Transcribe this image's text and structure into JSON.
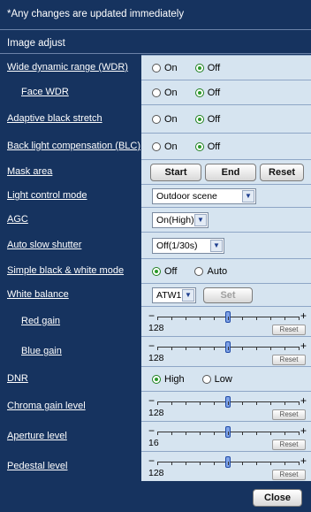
{
  "notice": "*Any changes are updated immediately",
  "section_title": "Image adjust",
  "rows": {
    "wdr": {
      "label": "Wide dynamic range (WDR)",
      "on": "On",
      "off": "Off",
      "selected": "off"
    },
    "face_wdr": {
      "label": "Face WDR",
      "on": "On",
      "off": "Off",
      "selected": "off"
    },
    "abs": {
      "label": "Adaptive black stretch",
      "on": "On",
      "off": "Off",
      "selected": "off"
    },
    "blc": {
      "label": "Back light compensation (BLC)",
      "on": "On",
      "off": "Off",
      "selected": "off"
    },
    "mask": {
      "label": "Mask area",
      "start": "Start",
      "end": "End",
      "reset": "Reset"
    },
    "light": {
      "label": "Light control mode",
      "value": "Outdoor scene"
    },
    "agc": {
      "label": "AGC",
      "value": "On(High)"
    },
    "shutter": {
      "label": "Auto slow shutter",
      "value": "Off(1/30s)"
    },
    "bw": {
      "label": "Simple black & white mode",
      "off": "Off",
      "auto": "Auto",
      "selected": "off"
    },
    "wb": {
      "label": "White balance",
      "value": "ATW1",
      "set": "Set"
    },
    "red_gain": {
      "label": "Red gain",
      "value": "128",
      "reset": "Reset",
      "level": 0.5
    },
    "blue_gain": {
      "label": "Blue gain",
      "value": "128",
      "reset": "Reset",
      "level": 0.5
    },
    "dnr": {
      "label": "DNR",
      "high": "High",
      "low": "Low",
      "selected": "high"
    },
    "chroma": {
      "label": "Chroma gain level",
      "value": "128",
      "reset": "Reset",
      "level": 0.5
    },
    "aperture": {
      "label": "Aperture level",
      "value": "16",
      "reset": "Reset",
      "level": 0.5
    },
    "pedestal": {
      "label": "Pedestal level",
      "value": "128",
      "reset": "Reset",
      "level": 0.5
    }
  },
  "close": "Close"
}
